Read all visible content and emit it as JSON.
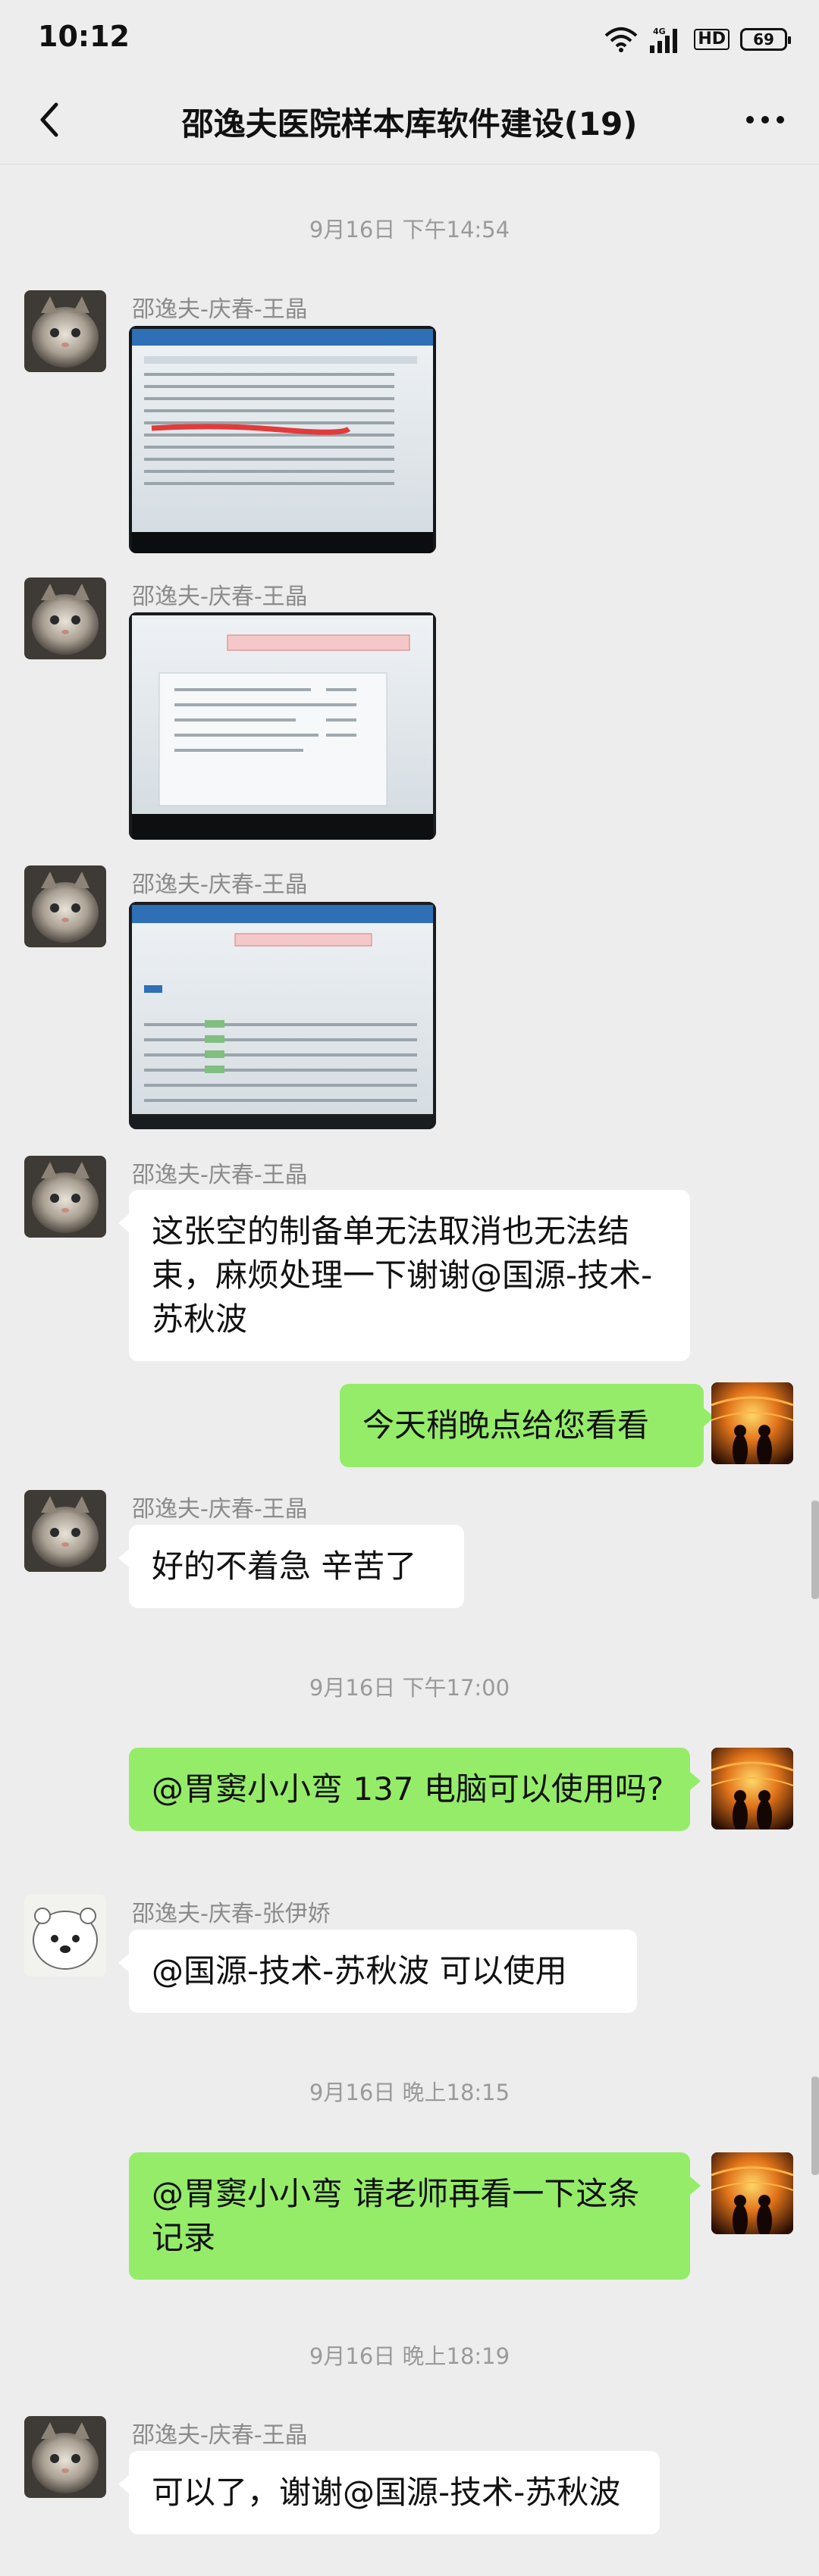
{
  "status_bar": {
    "time": "10:12",
    "network": "4G",
    "hd": "HD",
    "battery": "69"
  },
  "header": {
    "title": "邵逸夫医院样本库软件建设(19)"
  },
  "timestamps": [
    "9月16日 下午14:54",
    "9月16日 下午17:00",
    "9月16日 晚上18:15",
    "9月16日 晚上18:19"
  ],
  "senders": {
    "wangjing": "邵逸夫-庆春-王晶",
    "zhangyijiao": "邵逸夫-庆春-张伊娇"
  },
  "messages": {
    "m4": "这张空的制备单无法取消也无法结束，麻烦处理一下谢谢@国源-技术-苏秋波",
    "m5": "今天稍晚点给您看看",
    "m6": "好的不着急 辛苦了",
    "m7": "@胃窦小小弯  137 电脑可以使用吗?",
    "m8": "@国源-技术-苏秋波  可以使用",
    "m9": "@胃窦小小弯  请老师再看一下这条记录",
    "m10": "可以了，谢谢@国源-技术-苏秋波"
  },
  "colors": {
    "background": "#ededed",
    "bubble_self": "#95ec69",
    "bubble_other": "#ffffff"
  },
  "icons": [
    "back-arrow-icon",
    "more-icon",
    "wifi-icon",
    "signal-icon",
    "battery-icon"
  ]
}
